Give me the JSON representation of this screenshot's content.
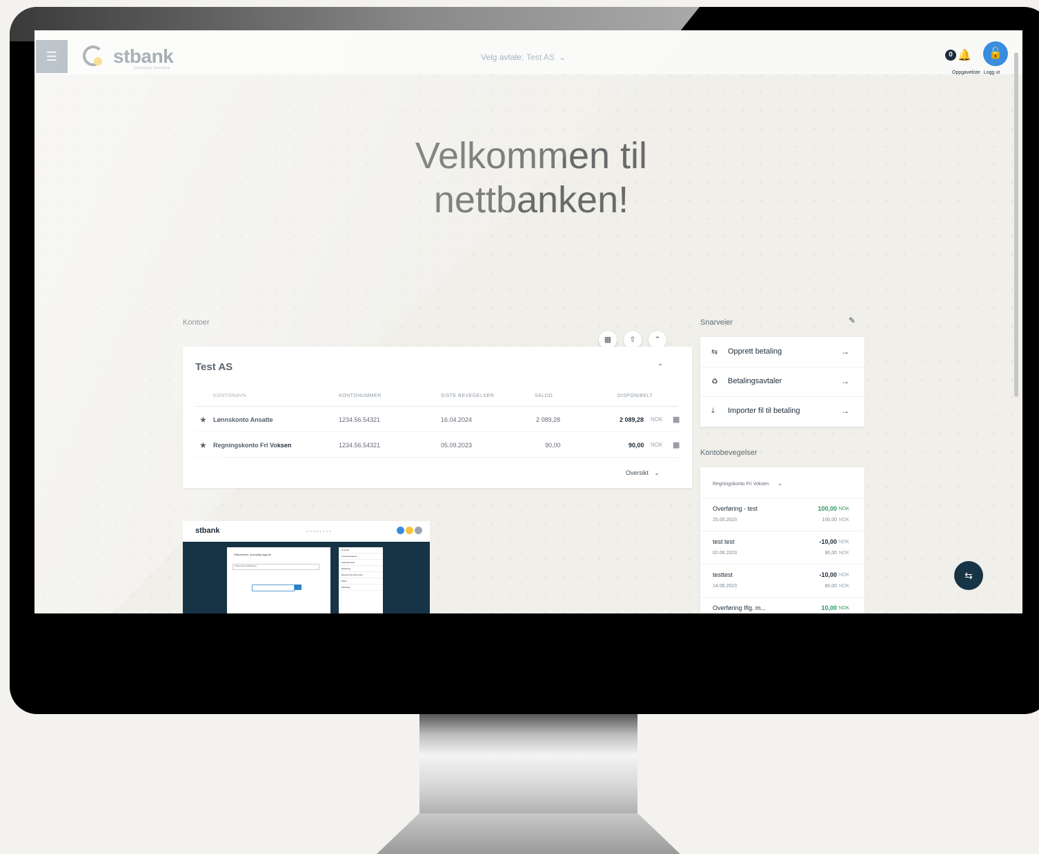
{
  "header": {
    "bank_name": "stbank",
    "bank_subtitle": "Drevsebygd Sparebank",
    "agreement_label": "Velg avtale:",
    "agreement_value": "Test AS",
    "notifications_count": "0",
    "task_list_label": "Oppgaveliste",
    "logout_label": "Logg ut"
  },
  "hero": {
    "line1": "Velkommen til",
    "line2": "nettbanken!"
  },
  "accounts": {
    "section_label": "Kontoer",
    "company": "Test AS",
    "columns": [
      "KONTONAVN",
      "KONTONUMMER",
      "SISTE BEVEGELSER",
      "SALDO",
      "DISPONIBELT"
    ],
    "rows": [
      {
        "name": "Lønnskonto Ansatte",
        "number": "1234.56.54321",
        "last_movement": "16.04.2024",
        "balance": "2 089,28",
        "available": "2 089,28",
        "currency": "NOK"
      },
      {
        "name": "Regningskonto Fri Voksen",
        "number": "1234.56.54321",
        "last_movement": "05.09.2023",
        "balance": "90,00",
        "available": "90,00",
        "currency": "NOK"
      }
    ],
    "overview_label": "Oversikt"
  },
  "shortcuts": {
    "section_label": "Snarveier",
    "items": [
      {
        "label": "Opprett betaling",
        "icon": "transfer-icon"
      },
      {
        "label": "Betalingsavtaler",
        "icon": "agreement-icon"
      },
      {
        "label": "Importer fil til betaling",
        "icon": "import-icon"
      }
    ]
  },
  "movements": {
    "section_label": "Kontobevegelser",
    "selected_account": "Regningskonto Fri Voksen",
    "items": [
      {
        "desc": "Overføring - test",
        "date": "25.05.2023",
        "amount": "100,00",
        "currency": "NOK",
        "balance": "100,00",
        "positive": true
      },
      {
        "desc": "test test",
        "date": "02.06.2023",
        "amount": "-10,00",
        "currency": "NOK",
        "balance": "90,00",
        "positive": false
      },
      {
        "desc": "testtest",
        "date": "14.06.2023",
        "amount": "-10,00",
        "currency": "NOK",
        "balance": "80,00",
        "positive": false
      },
      {
        "desc": "Overføring Iflg. m...",
        "date": "",
        "amount": "10,00",
        "currency": "NOK",
        "balance": "",
        "positive": true
      }
    ]
  },
  "thumbnail": {
    "logo": "stbank",
    "welcome": "Velkommen, ansvarlig logg inn",
    "select": "Testbedrift bedriftskonto",
    "menu": [
      "Oversikt",
      "Kontobevegelser",
      "Sparetjenester",
      "Betalinger",
      "Eksporter/Importer filer",
      "Bilder",
      "Meldinger"
    ]
  },
  "colors": {
    "brand_dark": "#173446",
    "accent_blue": "#3a8dde",
    "positive_green": "#2a9a5e",
    "logo_yellow": "#f3c73b"
  }
}
